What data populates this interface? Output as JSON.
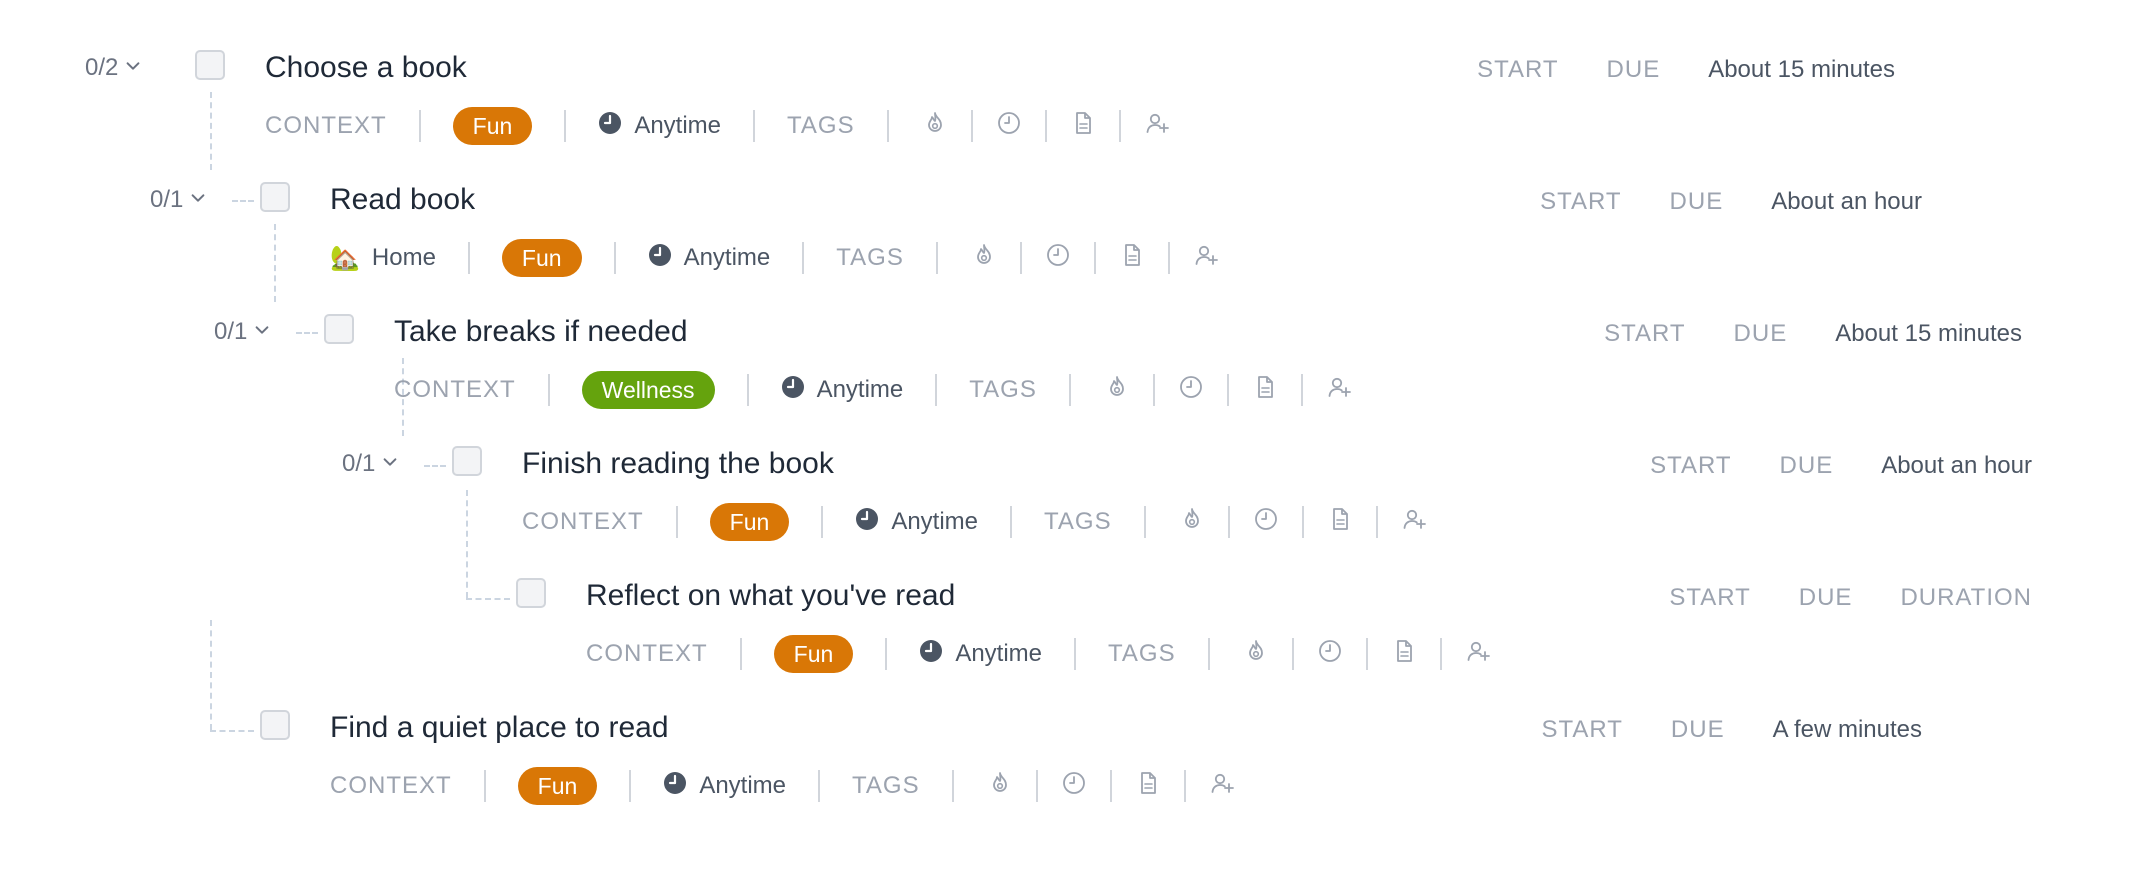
{
  "tasks": [
    {
      "progress": "0/2",
      "title": "Choose a book",
      "start_label": "START",
      "due_label": "DUE",
      "duration": "About 15 minutes",
      "context": "CONTEXT",
      "context_emoji": "",
      "category": "Fun",
      "category_color": "#d97706",
      "when": "Anytime",
      "tags": "TAGS"
    },
    {
      "progress": "0/1",
      "title": "Read book",
      "start_label": "START",
      "due_label": "DUE",
      "duration": "About an hour",
      "context": "Home",
      "context_emoji": "🏡",
      "category": "Fun",
      "category_color": "#d97706",
      "when": "Anytime",
      "tags": "TAGS"
    },
    {
      "progress": "0/1",
      "title": "Take breaks if needed",
      "start_label": "START",
      "due_label": "DUE",
      "duration": "About 15 minutes",
      "context": "CONTEXT",
      "context_emoji": "",
      "category": "Wellness",
      "category_color": "#65a30d",
      "when": "Anytime",
      "tags": "TAGS"
    },
    {
      "progress": "0/1",
      "title": "Finish reading the book",
      "start_label": "START",
      "due_label": "DUE",
      "duration": "About an hour",
      "context": "CONTEXT",
      "context_emoji": "",
      "category": "Fun",
      "category_color": "#d97706",
      "when": "Anytime",
      "tags": "TAGS"
    },
    {
      "progress": "",
      "title": "Reflect on what you've read",
      "start_label": "START",
      "due_label": "DUE",
      "duration": "DURATION",
      "context": "CONTEXT",
      "context_emoji": "",
      "category": "Fun",
      "category_color": "#d97706",
      "when": "Anytime",
      "tags": "TAGS"
    },
    {
      "progress": "",
      "title": "Find a quiet place to read",
      "start_label": "START",
      "due_label": "DUE",
      "duration": "A few minutes",
      "context": "CONTEXT",
      "context_emoji": "",
      "category": "Fun",
      "category_color": "#d97706",
      "when": "Anytime",
      "tags": "TAGS"
    }
  ],
  "icons": {
    "progress_toggle": "chevron-down-icon",
    "when": "clock-filled-icon",
    "priority": "flame-icon",
    "reminder": "clock-outline-icon",
    "notes": "document-icon",
    "assign": "add-user-icon"
  }
}
